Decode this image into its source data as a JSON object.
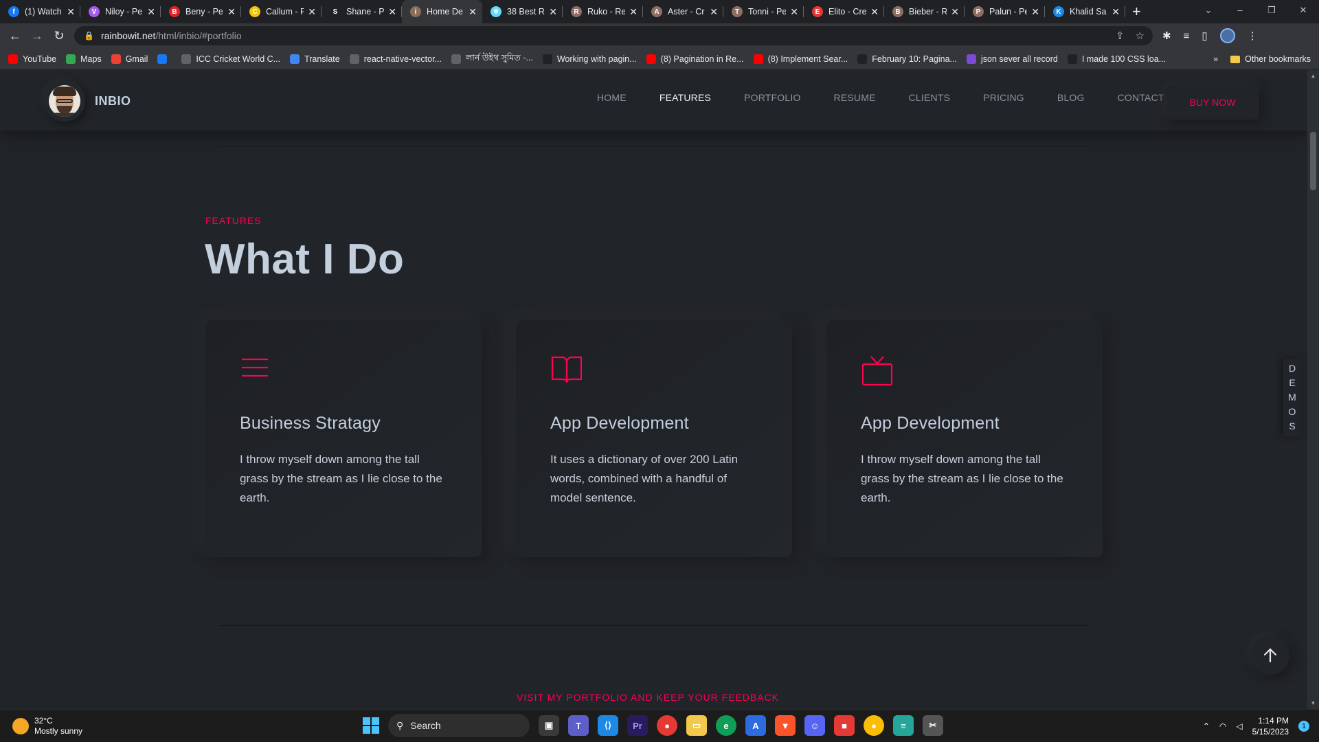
{
  "browser": {
    "tabs": [
      {
        "label": "(1) Watch",
        "favicon_color": "#1877f2",
        "favicon": "f"
      },
      {
        "label": "Niloy - Pe",
        "favicon_color": "#a55eea",
        "favicon": "V"
      },
      {
        "label": "Beny - Pe",
        "favicon_color": "#e02424",
        "favicon": "B"
      },
      {
        "label": "Callum - P",
        "favicon_color": "#f1c40f",
        "favicon": "C"
      },
      {
        "label": "Shane - P",
        "favicon_color": "#202124",
        "favicon": "S"
      },
      {
        "label": "Home De",
        "favicon_color": "#8a6d5a",
        "favicon": "i",
        "active": true
      },
      {
        "label": "38 Best R",
        "favicon_color": "#61dafb",
        "favicon": "⚛"
      },
      {
        "label": "Ruko - Re",
        "favicon_color": "#8d6e63",
        "favicon": "R"
      },
      {
        "label": "Aster - Cr",
        "favicon_color": "#8d6e63",
        "favicon": "A"
      },
      {
        "label": "Tonni - Pe",
        "favicon_color": "#8d6e63",
        "favicon": "T"
      },
      {
        "label": "Elito - Cre",
        "favicon_color": "#e53935",
        "favicon": "E"
      },
      {
        "label": "Bieber - R",
        "favicon_color": "#8d6e63",
        "favicon": "B"
      },
      {
        "label": "Palun - Pe",
        "favicon_color": "#8d6e63",
        "favicon": "P"
      },
      {
        "label": "Khalid Sa",
        "favicon_color": "#1e88e5",
        "favicon": "K"
      }
    ],
    "url_host": "rainbowit.net",
    "url_path": "/html/inbio/#portfolio",
    "bookmarks": [
      {
        "label": "YouTube",
        "color": "#ff0000"
      },
      {
        "label": "Maps",
        "color": "#34a853"
      },
      {
        "label": "Gmail",
        "color": "#ea4335"
      },
      {
        "label": "",
        "color": "#1877f2"
      },
      {
        "label": "ICC Cricket World C...",
        "color": "#5f6368"
      },
      {
        "label": "Translate",
        "color": "#4285f4"
      },
      {
        "label": "react-native-vector...",
        "color": "#5f6368"
      },
      {
        "label": "লার্ন উইথ সুমিত -...",
        "color": "#5f6368"
      },
      {
        "label": "Working with pagin...",
        "color": "#202124"
      },
      {
        "label": "(8) Pagination in Re...",
        "color": "#ff0000"
      },
      {
        "label": "(8) Implement Sear...",
        "color": "#ff0000"
      },
      {
        "label": "February 10: Pagina...",
        "color": "#202124"
      },
      {
        "label": "json sever all record",
        "color": "#7b4bd6"
      },
      {
        "label": "I made 100 CSS loa...",
        "color": "#202124"
      }
    ],
    "other_bookmarks": "Other bookmarks",
    "more": "»"
  },
  "site": {
    "brand": "INBIO",
    "menu": [
      "HOME",
      "FEATURES",
      "PORTFOLIO",
      "RESUME",
      "CLIENTS",
      "PRICING",
      "BLOG",
      "CONTACT"
    ],
    "active_menu": "FEATURES",
    "buy_now": "BUY NOW",
    "accent": "#ff014f",
    "section_subtitle": "FEATURES",
    "section_title": "What I Do",
    "cards": [
      {
        "icon": "menu-lines-icon",
        "title": "Business Stratagy",
        "text": "I throw myself down among the tall grass by the stream as I lie close to the earth."
      },
      {
        "icon": "book-icon",
        "title": "App Development",
        "text": "It uses a dictionary of over 200 Latin words, combined with a handful of model sentence."
      },
      {
        "icon": "tv-icon",
        "title": "App Development",
        "text": "I throw myself down among the tall grass by the stream as I lie close to the earth."
      }
    ],
    "demos_letters": [
      "D",
      "E",
      "M",
      "O",
      "S"
    ],
    "portfolio_subtitle": "VISIT MY PORTFOLIO AND KEEP YOUR FEEDBACK"
  },
  "taskbar": {
    "temp": "32°C",
    "weather": "Mostly sunny",
    "search": "Search",
    "time": "1:14 PM",
    "date": "5/15/2023",
    "notifications": "1"
  }
}
